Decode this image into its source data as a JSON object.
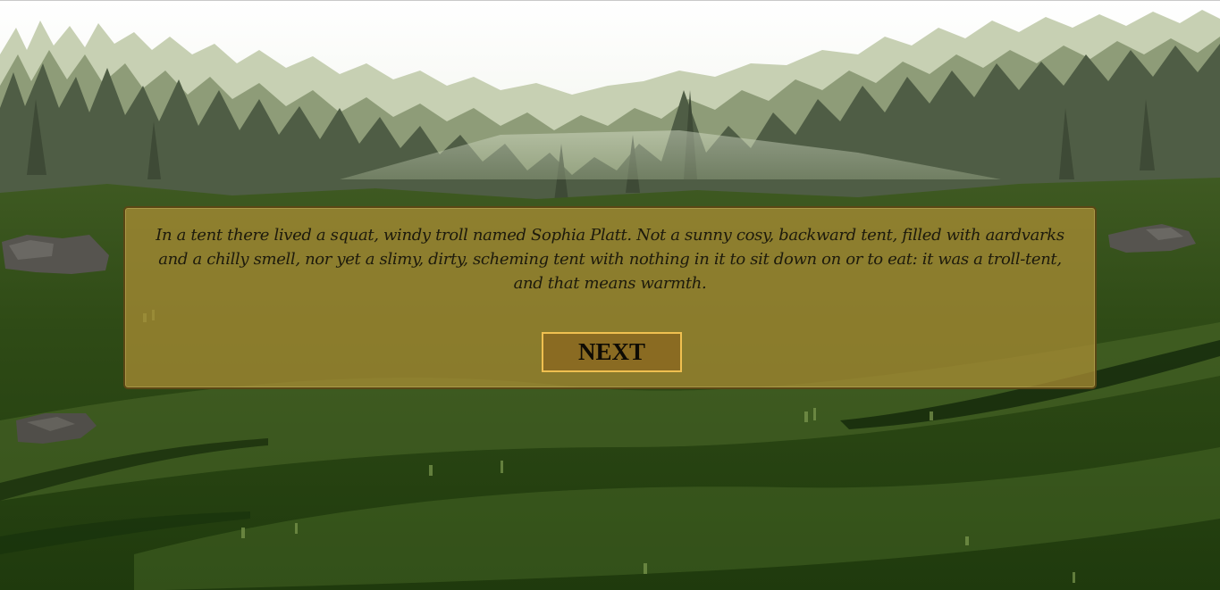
{
  "scene": {
    "background": "pixel-art forest meadow",
    "colors": {
      "sky": "#ffffff",
      "far_trees": "#b9c4a2",
      "mid_trees": "#7f8e6a",
      "near_trees": "#48553f",
      "meadow": "#2f4a17",
      "meadow_dark": "#15290a",
      "rock": "#56544f"
    }
  },
  "dialog": {
    "text": "In a tent there lived a squat, windy troll named Sophia Platt. Not a sunny cosy, backward tent, filled with aardvarks and a chilly smell, nor yet a slimy, dirty, scheming tent with nothing in it to sit down on or to eat: it was a troll-tent, and that means warmth.",
    "next_label": "NEXT",
    "colors": {
      "panel": "#ac8e34",
      "panel_border": "#5a4714",
      "button": "#8a6b22",
      "button_border": "#f0c050"
    }
  }
}
